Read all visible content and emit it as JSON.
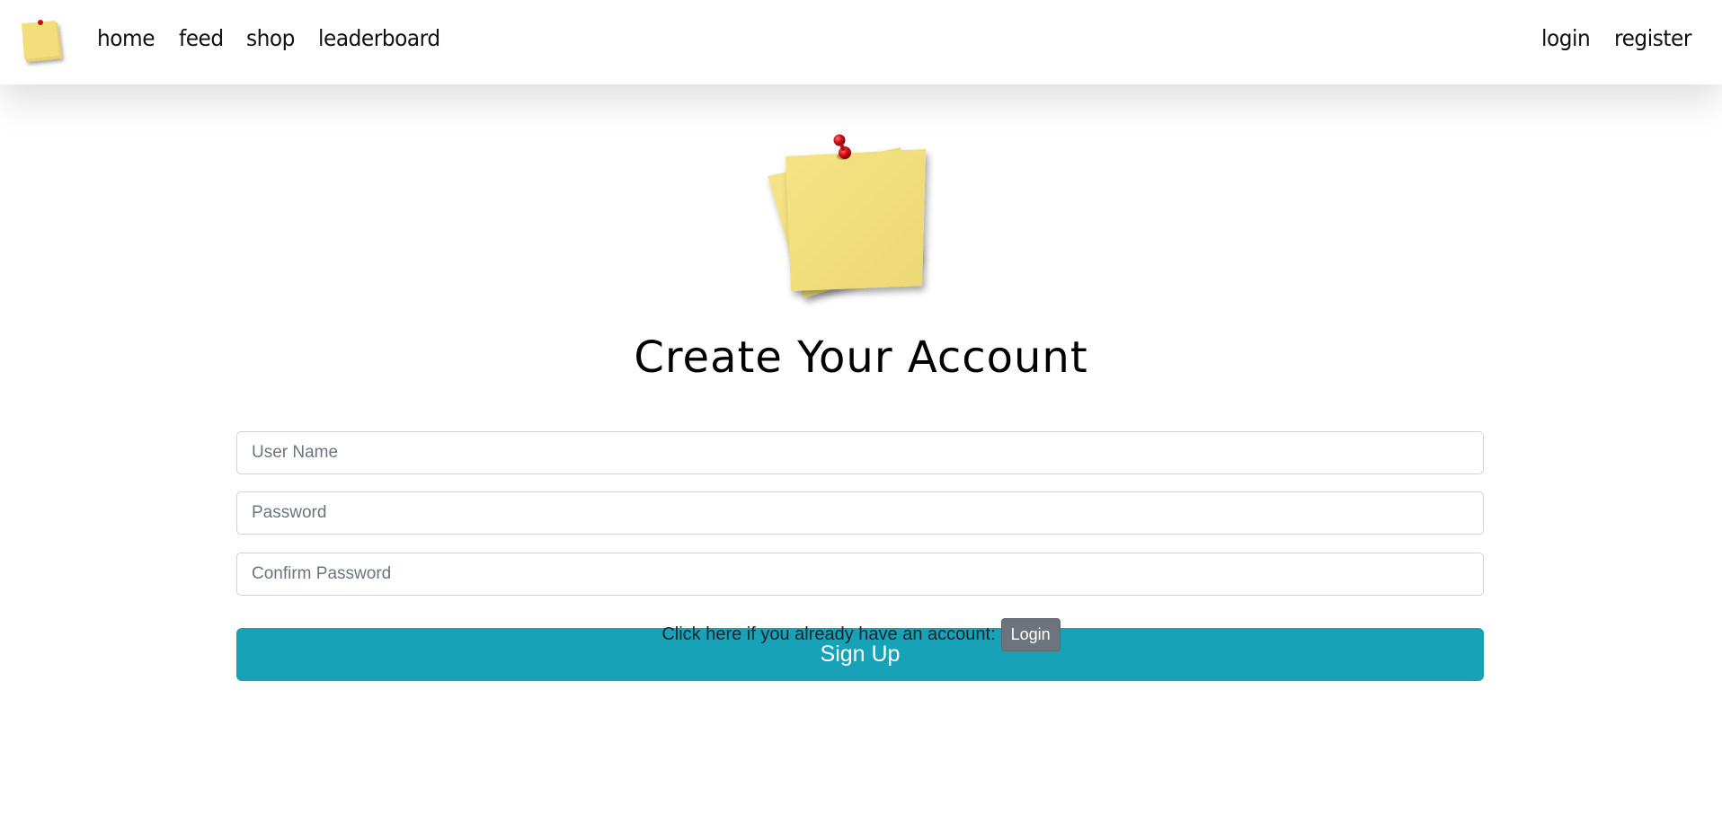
{
  "nav": {
    "logo_icon": "sticky-note-icon",
    "links": [
      "home",
      "feed",
      "shop",
      "leaderboard"
    ],
    "right_links": [
      "login",
      "register"
    ]
  },
  "hero": {
    "icon": "pinned-sticky-notes-icon"
  },
  "page": {
    "title": "Create Your Account"
  },
  "form": {
    "username_placeholder": "User Name",
    "password_placeholder": "Password",
    "confirm_placeholder": "Confirm Password",
    "signup_label": "Sign Up"
  },
  "login_prompt": {
    "text": "Click here if you already have an account:",
    "button_label": "Login"
  },
  "colors": {
    "accent": "#17a2b8",
    "secondary": "#6c757d",
    "note_yellow": "#f2df7b",
    "pin_red": "#cc0b12"
  }
}
